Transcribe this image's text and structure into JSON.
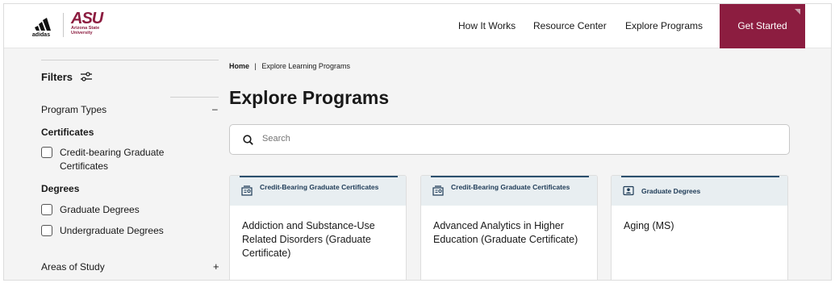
{
  "header": {
    "brand_adidas": "adidas",
    "brand_asu": "ASU",
    "brand_asu_sub_1": "Arizona State",
    "brand_asu_sub_2": "University",
    "nav": [
      "How It Works",
      "Resource Center",
      "Explore Programs"
    ],
    "cta": "Get Started"
  },
  "sidebar": {
    "filters_label": "Filters",
    "program_types_label": "Program Types",
    "program_types_toggle": "–",
    "groups": [
      {
        "label": "Certificates",
        "options": [
          "Credit-bearing Graduate Certificates"
        ]
      },
      {
        "label": "Degrees",
        "options": [
          "Graduate Degrees",
          "Undergraduate Degrees"
        ]
      }
    ],
    "areas_label": "Areas of Study",
    "areas_toggle": "+"
  },
  "breadcrumb": {
    "home": "Home",
    "separator": "|",
    "current": "Explore Learning Programs"
  },
  "page_title": "Explore Programs",
  "search": {
    "placeholder": "Search"
  },
  "cards": [
    {
      "category": "Credit-Bearing Graduate Certificates",
      "category_icon": "certificate-icon",
      "title": "Addiction and Substance-Use Related Disorders (Graduate Certificate)"
    },
    {
      "category": "Credit-Bearing Graduate Certificates",
      "category_icon": "certificate-icon",
      "title": "Advanced Analytics in Higher Education (Graduate Certificate)"
    },
    {
      "category": "Graduate Degrees",
      "category_icon": "degree-icon",
      "title": "Aging (MS)"
    }
  ],
  "colors": {
    "brand_maroon": "#8c1d40",
    "card_accent": "#2b4f6d",
    "card_header_bg": "#e8eef1"
  }
}
